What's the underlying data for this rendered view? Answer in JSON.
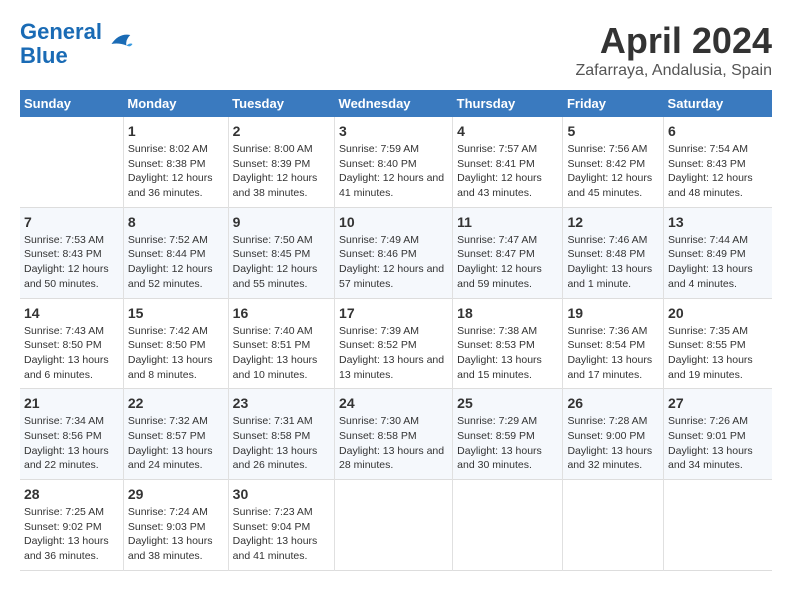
{
  "header": {
    "logo_line1": "General",
    "logo_line2": "Blue",
    "title": "April 2024",
    "subtitle": "Zafarraya, Andalusia, Spain"
  },
  "days_of_week": [
    "Sunday",
    "Monday",
    "Tuesday",
    "Wednesday",
    "Thursday",
    "Friday",
    "Saturday"
  ],
  "weeks": [
    [
      {
        "day": "",
        "sunrise": "",
        "sunset": "",
        "daylight": ""
      },
      {
        "day": "1",
        "sunrise": "Sunrise: 8:02 AM",
        "sunset": "Sunset: 8:38 PM",
        "daylight": "Daylight: 12 hours and 36 minutes."
      },
      {
        "day": "2",
        "sunrise": "Sunrise: 8:00 AM",
        "sunset": "Sunset: 8:39 PM",
        "daylight": "Daylight: 12 hours and 38 minutes."
      },
      {
        "day": "3",
        "sunrise": "Sunrise: 7:59 AM",
        "sunset": "Sunset: 8:40 PM",
        "daylight": "Daylight: 12 hours and 41 minutes."
      },
      {
        "day": "4",
        "sunrise": "Sunrise: 7:57 AM",
        "sunset": "Sunset: 8:41 PM",
        "daylight": "Daylight: 12 hours and 43 minutes."
      },
      {
        "day": "5",
        "sunrise": "Sunrise: 7:56 AM",
        "sunset": "Sunset: 8:42 PM",
        "daylight": "Daylight: 12 hours and 45 minutes."
      },
      {
        "day": "6",
        "sunrise": "Sunrise: 7:54 AM",
        "sunset": "Sunset: 8:43 PM",
        "daylight": "Daylight: 12 hours and 48 minutes."
      }
    ],
    [
      {
        "day": "7",
        "sunrise": "Sunrise: 7:53 AM",
        "sunset": "Sunset: 8:43 PM",
        "daylight": "Daylight: 12 hours and 50 minutes."
      },
      {
        "day": "8",
        "sunrise": "Sunrise: 7:52 AM",
        "sunset": "Sunset: 8:44 PM",
        "daylight": "Daylight: 12 hours and 52 minutes."
      },
      {
        "day": "9",
        "sunrise": "Sunrise: 7:50 AM",
        "sunset": "Sunset: 8:45 PM",
        "daylight": "Daylight: 12 hours and 55 minutes."
      },
      {
        "day": "10",
        "sunrise": "Sunrise: 7:49 AM",
        "sunset": "Sunset: 8:46 PM",
        "daylight": "Daylight: 12 hours and 57 minutes."
      },
      {
        "day": "11",
        "sunrise": "Sunrise: 7:47 AM",
        "sunset": "Sunset: 8:47 PM",
        "daylight": "Daylight: 12 hours and 59 minutes."
      },
      {
        "day": "12",
        "sunrise": "Sunrise: 7:46 AM",
        "sunset": "Sunset: 8:48 PM",
        "daylight": "Daylight: 13 hours and 1 minute."
      },
      {
        "day": "13",
        "sunrise": "Sunrise: 7:44 AM",
        "sunset": "Sunset: 8:49 PM",
        "daylight": "Daylight: 13 hours and 4 minutes."
      }
    ],
    [
      {
        "day": "14",
        "sunrise": "Sunrise: 7:43 AM",
        "sunset": "Sunset: 8:50 PM",
        "daylight": "Daylight: 13 hours and 6 minutes."
      },
      {
        "day": "15",
        "sunrise": "Sunrise: 7:42 AM",
        "sunset": "Sunset: 8:50 PM",
        "daylight": "Daylight: 13 hours and 8 minutes."
      },
      {
        "day": "16",
        "sunrise": "Sunrise: 7:40 AM",
        "sunset": "Sunset: 8:51 PM",
        "daylight": "Daylight: 13 hours and 10 minutes."
      },
      {
        "day": "17",
        "sunrise": "Sunrise: 7:39 AM",
        "sunset": "Sunset: 8:52 PM",
        "daylight": "Daylight: 13 hours and 13 minutes."
      },
      {
        "day": "18",
        "sunrise": "Sunrise: 7:38 AM",
        "sunset": "Sunset: 8:53 PM",
        "daylight": "Daylight: 13 hours and 15 minutes."
      },
      {
        "day": "19",
        "sunrise": "Sunrise: 7:36 AM",
        "sunset": "Sunset: 8:54 PM",
        "daylight": "Daylight: 13 hours and 17 minutes."
      },
      {
        "day": "20",
        "sunrise": "Sunrise: 7:35 AM",
        "sunset": "Sunset: 8:55 PM",
        "daylight": "Daylight: 13 hours and 19 minutes."
      }
    ],
    [
      {
        "day": "21",
        "sunrise": "Sunrise: 7:34 AM",
        "sunset": "Sunset: 8:56 PM",
        "daylight": "Daylight: 13 hours and 22 minutes."
      },
      {
        "day": "22",
        "sunrise": "Sunrise: 7:32 AM",
        "sunset": "Sunset: 8:57 PM",
        "daylight": "Daylight: 13 hours and 24 minutes."
      },
      {
        "day": "23",
        "sunrise": "Sunrise: 7:31 AM",
        "sunset": "Sunset: 8:58 PM",
        "daylight": "Daylight: 13 hours and 26 minutes."
      },
      {
        "day": "24",
        "sunrise": "Sunrise: 7:30 AM",
        "sunset": "Sunset: 8:58 PM",
        "daylight": "Daylight: 13 hours and 28 minutes."
      },
      {
        "day": "25",
        "sunrise": "Sunrise: 7:29 AM",
        "sunset": "Sunset: 8:59 PM",
        "daylight": "Daylight: 13 hours and 30 minutes."
      },
      {
        "day": "26",
        "sunrise": "Sunrise: 7:28 AM",
        "sunset": "Sunset: 9:00 PM",
        "daylight": "Daylight: 13 hours and 32 minutes."
      },
      {
        "day": "27",
        "sunrise": "Sunrise: 7:26 AM",
        "sunset": "Sunset: 9:01 PM",
        "daylight": "Daylight: 13 hours and 34 minutes."
      }
    ],
    [
      {
        "day": "28",
        "sunrise": "Sunrise: 7:25 AM",
        "sunset": "Sunset: 9:02 PM",
        "daylight": "Daylight: 13 hours and 36 minutes."
      },
      {
        "day": "29",
        "sunrise": "Sunrise: 7:24 AM",
        "sunset": "Sunset: 9:03 PM",
        "daylight": "Daylight: 13 hours and 38 minutes."
      },
      {
        "day": "30",
        "sunrise": "Sunrise: 7:23 AM",
        "sunset": "Sunset: 9:04 PM",
        "daylight": "Daylight: 13 hours and 41 minutes."
      },
      {
        "day": "",
        "sunrise": "",
        "sunset": "",
        "daylight": ""
      },
      {
        "day": "",
        "sunrise": "",
        "sunset": "",
        "daylight": ""
      },
      {
        "day": "",
        "sunrise": "",
        "sunset": "",
        "daylight": ""
      },
      {
        "day": "",
        "sunrise": "",
        "sunset": "",
        "daylight": ""
      }
    ]
  ]
}
